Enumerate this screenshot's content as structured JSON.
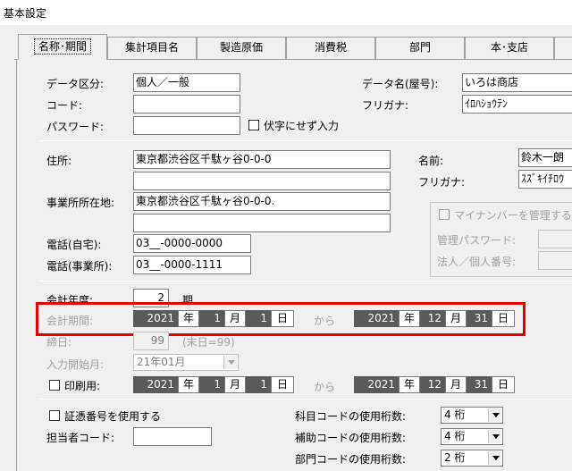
{
  "window": {
    "title": "基本設定"
  },
  "tabs": [
    {
      "label": "名称･期間"
    },
    {
      "label": "集計項目名"
    },
    {
      "label": "製造原価"
    },
    {
      "label": "消費税"
    },
    {
      "label": "部門"
    },
    {
      "label": "本･支店"
    }
  ],
  "basic": {
    "data_kubun_label": "データ区分:",
    "data_kubun_value": "個人／一般",
    "code_label": "コード:",
    "code_value": "",
    "password_label": "パスワード:",
    "password_value": "",
    "mask_input_label": "伏字にせず入力",
    "data_name_label": "データ名(屋号):",
    "data_name_value": "いろは商店",
    "furigana_label": "フリガナ:",
    "furigana_value": "ｲﾛﾊｼｮｳﾃﾝ"
  },
  "address": {
    "address_label": "住所:",
    "address_value": "東京都渋谷区千駄ヶ谷0-0-0",
    "address2_value": "",
    "office_label": "事業所所在地:",
    "office_value": "東京都渋谷区千駄ヶ谷0-0-0.",
    "office2_value": "",
    "phone_home_label": "電話(自宅):",
    "phone_home_value": "03__-0000-0000",
    "phone_office_label": "電話(事業所):",
    "phone_office_value": "03__-0000-1111",
    "name_label": "名前:",
    "name_value": "鈴木一朗",
    "name_furigana_label": "フリガナ:",
    "name_furigana_value": "ｽｽﾞｷｲﾁﾛｳ"
  },
  "mynumber": {
    "manage_label": "マイナンバーを管理する",
    "password_label": "管理パスワード:",
    "number_label": "法人／個人番号:"
  },
  "period": {
    "fiscal_year_label": "会計年度:",
    "fiscal_year_value": "2",
    "fiscal_year_unit": "期",
    "period_label": "会計期間:",
    "from": {
      "year": "2021",
      "month": "1",
      "day": "1"
    },
    "to": {
      "year": "2021",
      "month": "12",
      "day": "31"
    },
    "kara": "から",
    "unit_year": "年",
    "unit_month": "月",
    "unit_day": "日",
    "closing_label": "締日:",
    "closing_value": "99",
    "closing_hint": "(末日=99)",
    "input_start_label": "入力開始月:",
    "input_start_value": "21年01月",
    "print_label": "印刷用:",
    "print_from": {
      "year": "2021",
      "month": "1",
      "day": "1"
    },
    "print_to": {
      "year": "2021",
      "month": "12",
      "day": "31"
    }
  },
  "bottom": {
    "voucher_label": "証憑番号を使用する",
    "person_label": "担当者コード:",
    "person_value": "",
    "account_digits_label": "科目コードの使用桁数:",
    "account_digits_value": "4 桁",
    "sub_digits_label": "補助コードの使用桁数:",
    "sub_digits_value": "4 桁",
    "dept_digits_label": "部門コードの使用桁数:",
    "dept_digits_value": "2 桁"
  }
}
